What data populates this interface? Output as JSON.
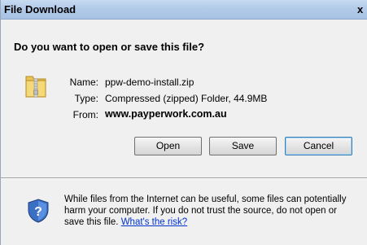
{
  "window": {
    "title": "File Download",
    "close_label": "x"
  },
  "dialog": {
    "heading": "Do you want to open or save this file?",
    "fields": {
      "name_label": "Name:",
      "name_value": "ppw-demo-install.zip",
      "type_label": "Type:",
      "type_value": "Compressed (zipped) Folder, 44.9MB",
      "from_label": "From:",
      "from_value": "www.payperwork.com.au"
    },
    "buttons": {
      "open": "Open",
      "save": "Save",
      "cancel": "Cancel"
    },
    "warning": {
      "line1": "While files from the Internet can be useful, some files can potentially",
      "line2": "harm your computer. If you do not trust the source, do not open or",
      "line3": "save this file.",
      "link": "What's the risk?"
    }
  },
  "icons": {
    "file": "zip-folder-icon",
    "warning": "security-shield-icon"
  }
}
